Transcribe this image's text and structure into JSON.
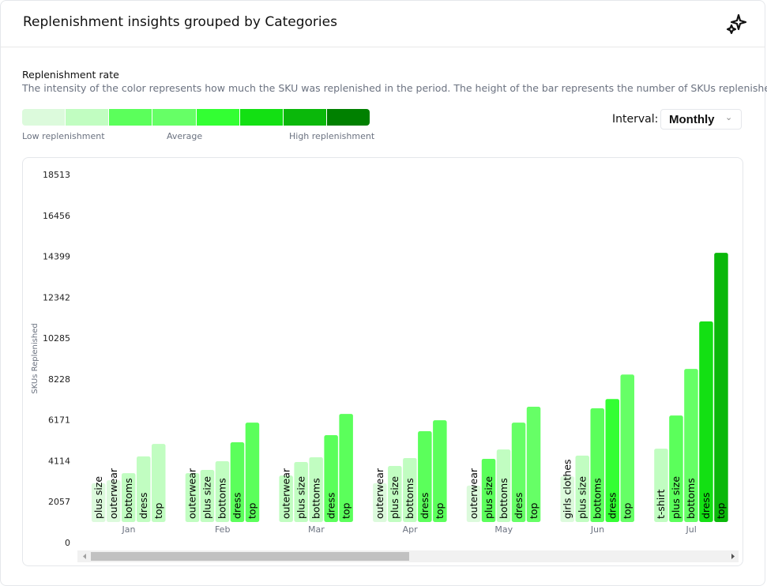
{
  "header": {
    "title": "Replenishment insights grouped by Categories",
    "icon": "sparkles-icon"
  },
  "legend": {
    "title": "Replenishment rate",
    "description": "The intensity of the color represents how much the SKU was replenished in the period. The height of the bar represents the number of SKUs replenished.",
    "colors": [
      "#dcfadc",
      "#c1fdc1",
      "#5bff5b",
      "#66ff66",
      "#33ff33",
      "#13e013",
      "#0ab80a",
      "#008000"
    ],
    "low": "Low replenishment",
    "mid": "Average",
    "high": "High replenishment"
  },
  "interval": {
    "label": "Interval:",
    "value": "Monthly"
  },
  "chart_data": {
    "type": "bar",
    "ylabel": "SKUs Replenished",
    "ylim": [
      0,
      18513
    ],
    "yticks": [
      0,
      2057,
      4114,
      6171,
      8228,
      10285,
      12342,
      14399,
      16456,
      18513
    ],
    "groups": [
      {
        "month": "Jan",
        "bars": [
          {
            "cat": "plus size",
            "value": 1950,
            "level": 0
          },
          {
            "cat": "outerwear",
            "value": 2100,
            "level": 0
          },
          {
            "cat": "bottoms",
            "value": 2460,
            "level": 1
          },
          {
            "cat": "dress",
            "value": 3300,
            "level": 1
          },
          {
            "cat": "top",
            "value": 3930,
            "level": 1
          }
        ]
      },
      {
        "month": "Feb",
        "bars": [
          {
            "cat": "outerwear",
            "value": 2460,
            "level": 1
          },
          {
            "cat": "plus size",
            "value": 2620,
            "level": 1
          },
          {
            "cat": "bottoms",
            "value": 3060,
            "level": 1
          },
          {
            "cat": "dress",
            "value": 4010,
            "level": 2
          },
          {
            "cat": "top",
            "value": 5000,
            "level": 2
          }
        ]
      },
      {
        "month": "Mar",
        "bars": [
          {
            "cat": "outerwear",
            "value": 2340,
            "level": 1
          },
          {
            "cat": "plus size",
            "value": 3020,
            "level": 1
          },
          {
            "cat": "bottoms",
            "value": 3260,
            "level": 1
          },
          {
            "cat": "dress",
            "value": 4370,
            "level": 2
          },
          {
            "cat": "top",
            "value": 5440,
            "level": 2
          }
        ]
      },
      {
        "month": "Apr",
        "bars": [
          {
            "cat": "outerwear",
            "value": 1950,
            "level": 0
          },
          {
            "cat": "plus size",
            "value": 2820,
            "level": 1
          },
          {
            "cat": "bottoms",
            "value": 3220,
            "level": 1
          },
          {
            "cat": "dress",
            "value": 4570,
            "level": 2
          },
          {
            "cat": "top",
            "value": 5120,
            "level": 2
          }
        ]
      },
      {
        "month": "May",
        "bars": [
          {
            "cat": "outerwear",
            "value": 1830,
            "level": 0
          },
          {
            "cat": "plus size",
            "value": 3180,
            "level": 2
          },
          {
            "cat": "bottoms",
            "value": 3650,
            "level": 1
          },
          {
            "cat": "dress",
            "value": 5000,
            "level": 3
          },
          {
            "cat": "top",
            "value": 5800,
            "level": 3
          }
        ]
      },
      {
        "month": "Jun",
        "bars": [
          {
            "cat": "girls clothes",
            "value": 2300,
            "level": 0
          },
          {
            "cat": "plus size",
            "value": 3340,
            "level": 1
          },
          {
            "cat": "bottoms",
            "value": 5720,
            "level": 2
          },
          {
            "cat": "dress",
            "value": 6190,
            "level": 4
          },
          {
            "cat": "top",
            "value": 7420,
            "level": 3
          }
        ]
      },
      {
        "month": "Jul",
        "bars": [
          {
            "cat": "t-shirt",
            "value": 3690,
            "level": 1
          },
          {
            "cat": "plus size",
            "value": 5360,
            "level": 2
          },
          {
            "cat": "bottoms",
            "value": 7700,
            "level": 3
          },
          {
            "cat": "dress",
            "value": 10090,
            "level": 5
          },
          {
            "cat": "top",
            "value": 13540,
            "level": 6
          }
        ]
      }
    ]
  }
}
